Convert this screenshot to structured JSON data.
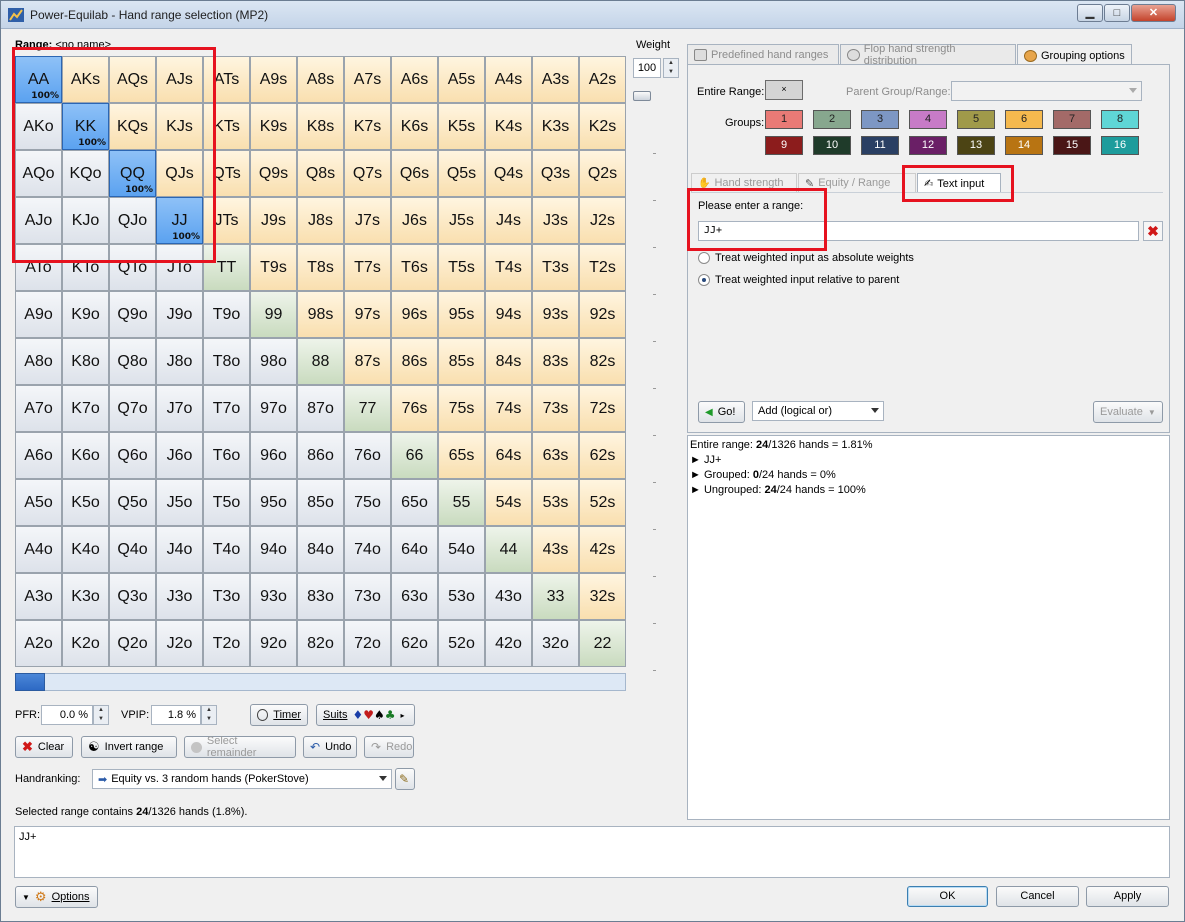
{
  "window": {
    "title": "Power-Equilab - Hand range selection (MP2)",
    "min_glyph": "▁",
    "max_glyph": "□",
    "close_glyph": "✕"
  },
  "range": {
    "label": "Range:",
    "name": "<no name>"
  },
  "grid": {
    "rows": [
      [
        "AA",
        "AKs",
        "AQs",
        "AJs",
        "ATs",
        "A9s",
        "A8s",
        "A7s",
        "A6s",
        "A5s",
        "A4s",
        "A3s",
        "A2s"
      ],
      [
        "AKo",
        "KK",
        "KQs",
        "KJs",
        "KTs",
        "K9s",
        "K8s",
        "K7s",
        "K6s",
        "K5s",
        "K4s",
        "K3s",
        "K2s"
      ],
      [
        "AQo",
        "KQo",
        "QQ",
        "QJs",
        "QTs",
        "Q9s",
        "Q8s",
        "Q7s",
        "Q6s",
        "Q5s",
        "Q4s",
        "Q3s",
        "Q2s"
      ],
      [
        "AJo",
        "KJo",
        "QJo",
        "JJ",
        "JTs",
        "J9s",
        "J8s",
        "J7s",
        "J6s",
        "J5s",
        "J4s",
        "J3s",
        "J2s"
      ],
      [
        "ATo",
        "KTo",
        "QTo",
        "JTo",
        "TT",
        "T9s",
        "T8s",
        "T7s",
        "T6s",
        "T5s",
        "T4s",
        "T3s",
        "T2s"
      ],
      [
        "A9o",
        "K9o",
        "Q9o",
        "J9o",
        "T9o",
        "99",
        "98s",
        "97s",
        "96s",
        "95s",
        "94s",
        "93s",
        "92s"
      ],
      [
        "A8o",
        "K8o",
        "Q8o",
        "J8o",
        "T8o",
        "98o",
        "88",
        "87s",
        "86s",
        "85s",
        "84s",
        "83s",
        "82s"
      ],
      [
        "A7o",
        "K7o",
        "Q7o",
        "J7o",
        "T7o",
        "97o",
        "87o",
        "77",
        "76s",
        "75s",
        "74s",
        "73s",
        "72s"
      ],
      [
        "A6o",
        "K6o",
        "Q6o",
        "J6o",
        "T6o",
        "96o",
        "86o",
        "76o",
        "66",
        "65s",
        "64s",
        "63s",
        "62s"
      ],
      [
        "A5o",
        "K5o",
        "Q5o",
        "J5o",
        "T5o",
        "95o",
        "85o",
        "75o",
        "65o",
        "55",
        "54s",
        "53s",
        "52s"
      ],
      [
        "A4o",
        "K4o",
        "Q4o",
        "J4o",
        "T4o",
        "94o",
        "84o",
        "74o",
        "64o",
        "54o",
        "44",
        "43s",
        "42s"
      ],
      [
        "A3o",
        "K3o",
        "Q3o",
        "J3o",
        "T3o",
        "93o",
        "83o",
        "73o",
        "63o",
        "53o",
        "43o",
        "33",
        "32s"
      ],
      [
        "A2o",
        "K2o",
        "Q2o",
        "J2o",
        "T2o",
        "92o",
        "82o",
        "72o",
        "62o",
        "52o",
        "42o",
        "32o",
        "22"
      ]
    ],
    "selected": [
      "AA",
      "KK",
      "QQ",
      "JJ"
    ],
    "selected_pct": "100%"
  },
  "weight": {
    "label": "Weight",
    "value": "100"
  },
  "stats": {
    "pfr_label": "PFR:",
    "pfr_value": "0.0 %",
    "vpip_label": "VPIP:",
    "vpip_value": "1.8 %",
    "timer_label": "Timer",
    "suits_label": "Suits"
  },
  "actions": {
    "clear": "Clear",
    "invert": "Invert range",
    "select_remainder": "Select remainder",
    "undo": "Undo",
    "redo": "Redo"
  },
  "handranking": {
    "label": "Handranking:",
    "value": "Equity vs. 3 random hands (PokerStove)"
  },
  "status": {
    "prefix": "Selected range contains ",
    "count": "24",
    "suffix": "/1326 hands (1.8%)."
  },
  "bottom_text": "JJ+",
  "tabs": [
    "Predefined hand ranges",
    "Flop hand strength distribution",
    "Grouping options"
  ],
  "grouping": {
    "entire_range_label": "Entire Range:",
    "entire_range_btn": "×",
    "parent_group_label": "Parent Group/Range:",
    "groups_label": "Groups:",
    "groups": [
      {
        "n": "1",
        "c": "#e97a76"
      },
      {
        "n": "2",
        "c": "#87a78e"
      },
      {
        "n": "3",
        "c": "#7d97c4"
      },
      {
        "n": "4",
        "c": "#c77bc7"
      },
      {
        "n": "5",
        "c": "#a09a4a"
      },
      {
        "n": "6",
        "c": "#f5b94e"
      },
      {
        "n": "7",
        "c": "#a36a68"
      },
      {
        "n": "8",
        "c": "#5fd6d6"
      },
      {
        "n": "9",
        "c": "#8c1c1c"
      },
      {
        "n": "10",
        "c": "#1f3b2a"
      },
      {
        "n": "11",
        "c": "#2a3f63"
      },
      {
        "n": "12",
        "c": "#6a1f66"
      },
      {
        "n": "13",
        "c": "#4c4414"
      },
      {
        "n": "14",
        "c": "#b87412"
      },
      {
        "n": "15",
        "c": "#4a1616"
      },
      {
        "n": "16",
        "c": "#1e9c9c"
      }
    ]
  },
  "subtabs": [
    "Hand strength",
    "Equity / Range",
    "Text input"
  ],
  "text_input": {
    "prompt": "Please enter a range:",
    "value": "JJ+",
    "opt_absolute": "Treat weighted input as absolute weights",
    "opt_relative": "Treat weighted input relative to parent",
    "go_label": "Go!",
    "mode_value": "Add (logical or)",
    "evaluate_label": "Evaluate"
  },
  "result": {
    "line1_prefix": "Entire range: ",
    "line1_count": "24",
    "line1_suffix": "/1326 hands = 1.81%",
    "line2": "JJ+",
    "line3_prefix": "Grouped: ",
    "line3_count": "0",
    "line3_suffix": "/24 hands = 0%",
    "line4_prefix": "Ungrouped: ",
    "line4_count": "24",
    "line4_suffix": "/24 hands = 100%",
    "bullet": "►"
  },
  "footer": {
    "options": "Options",
    "ok": "OK",
    "cancel": "Cancel",
    "apply": "Apply"
  }
}
